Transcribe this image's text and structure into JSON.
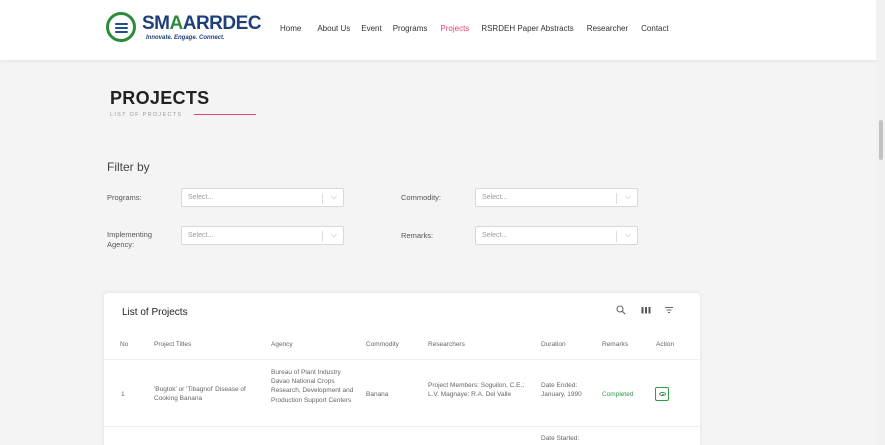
{
  "brand": {
    "name_pre": "SM",
    "name_a": "A",
    "name_post": "ARRDEC",
    "tagline": "Innovate. Engage. Connect."
  },
  "nav": [
    {
      "label": "Home"
    },
    {
      "label": "About Us"
    },
    {
      "label": "Event"
    },
    {
      "label": "Programs"
    },
    {
      "label": "Projects",
      "active": true
    },
    {
      "label": "RSRDEH Paper Abstracts"
    },
    {
      "label": "Researcher"
    },
    {
      "label": "Contact"
    }
  ],
  "page": {
    "title": "PROJECTS",
    "subtitle": "LIST OF PROJECTS"
  },
  "filter": {
    "title": "Filter by",
    "programs": {
      "label": "Programs:",
      "placeholder": "Select..."
    },
    "commodity": {
      "label": "Commodity:",
      "placeholder": "Select..."
    },
    "agency": {
      "label_1": "Implementing",
      "label_2": "Agency:",
      "placeholder": "Select..."
    },
    "remarks": {
      "label": "Remarks:",
      "placeholder": "Select..."
    }
  },
  "table": {
    "title": "List of Projects",
    "tools": {
      "search": "search-icon",
      "columns": "columns-icon",
      "filter": "filter-icon"
    },
    "columns": [
      "No",
      "Project Titles",
      "Agency",
      "Commodity",
      "Researchers",
      "Duration",
      "Remarks",
      "Action"
    ],
    "rows": [
      {
        "no": "1",
        "title": "'Bugtok' or 'Tibagnol' Disease of Cooking Banana",
        "agency": "Bureau of Plant Industry Davao National Crops Research, Development and Production Support Centers",
        "commodity": "Banana",
        "researchers": "Project Members: Soguilon, C.E.; L.V. Magnaye; R.A. Del Valle",
        "duration": "Date Ended: January, 1990",
        "remarks": "Completed"
      },
      {
        "duration": "Date Started:"
      }
    ]
  },
  "colors": {
    "accent": "#e0457b",
    "brand_blue": "#1f3f7a",
    "brand_green": "#2e8b3a",
    "status_green": "#2e9a48"
  }
}
